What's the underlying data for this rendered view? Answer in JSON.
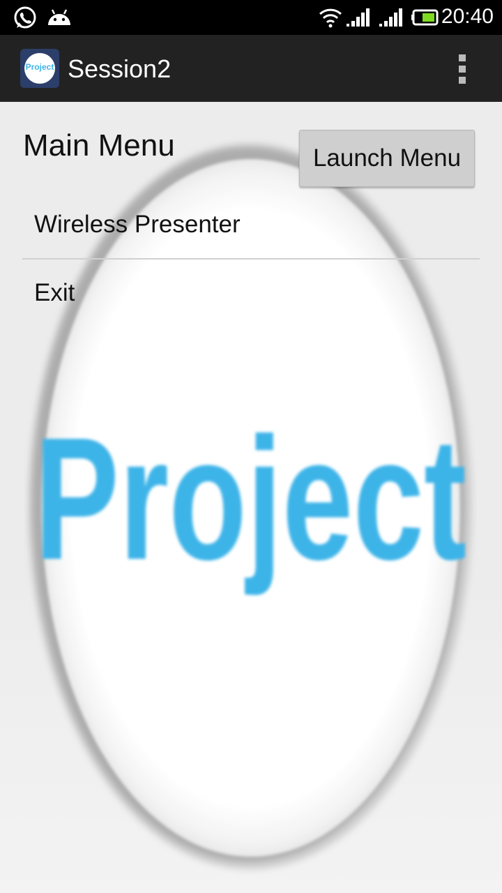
{
  "status_bar": {
    "time": "20:40",
    "icons": [
      "whatsapp-icon",
      "android-icon",
      "wifi-icon",
      "signal-icon-1",
      "signal-icon-2",
      "battery-icon"
    ]
  },
  "action_bar": {
    "app_icon_text": "Project",
    "title": "Session2",
    "overflow_icon": "overflow-menu-icon"
  },
  "main": {
    "title": "Main Menu",
    "launch_button": "Launch Menu",
    "menu_items": [
      {
        "label": "Wireless Presenter"
      },
      {
        "label": "Exit"
      }
    ]
  },
  "background_logo": {
    "text": "Project",
    "color": "#3eb4e8"
  },
  "colors": {
    "status_bar": "#000000",
    "action_bar": "#222222",
    "content_bg": "#ececec",
    "accent": "#3eb4e8"
  }
}
